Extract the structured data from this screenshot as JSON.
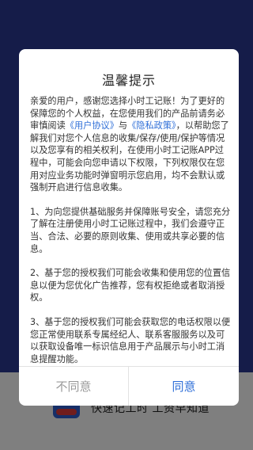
{
  "background": {
    "slogan": "快速记工时  工资早知道"
  },
  "dialog": {
    "title": "温馨提示",
    "intro": {
      "text_before_link1": "亲爱的用户，感谢您选择小时工记账！为了更好的保障您的个人权益，在您使用我们的产品前请务必审慎阅读",
      "link1": "《用户协议》",
      "text_between": "与",
      "link2": "《隐私政策》",
      "text_after": "，以帮助您了解我们对您个人信息的收集/保存/使用/保护等情况以及您享有的相关权利，在使用小时工记账APP过程中，可能会向您申请以下权限，下列权限仅在您用对应业务功能时弹窗明示您启用，均不会默认或强制开启进行信息收集。"
    },
    "paragraphs": [
      "1、为向您提供基础服务并保障账号安全，请您充分了解在注册使用小时工记账过程中，我们会遵守正当、合法、必要的原则收集、使用或共享必要的信息。",
      "2、基于您的授权我们可能会收集和使用您的位置信息以便为您优化广告推荐，您有权拒绝或者取消授权。",
      "3、基于您的授权我们可能会获取您的电话权限以便您正常使用联系专属经纪人、联系客服服务以及可以获取设备唯一标识信息用于产品展示与小时工消息提醒功能。"
    ],
    "disagree_label": "不同意",
    "agree_label": "同意"
  },
  "colors": {
    "accent": "#2f6fd8",
    "background_top": "#2a3893"
  }
}
